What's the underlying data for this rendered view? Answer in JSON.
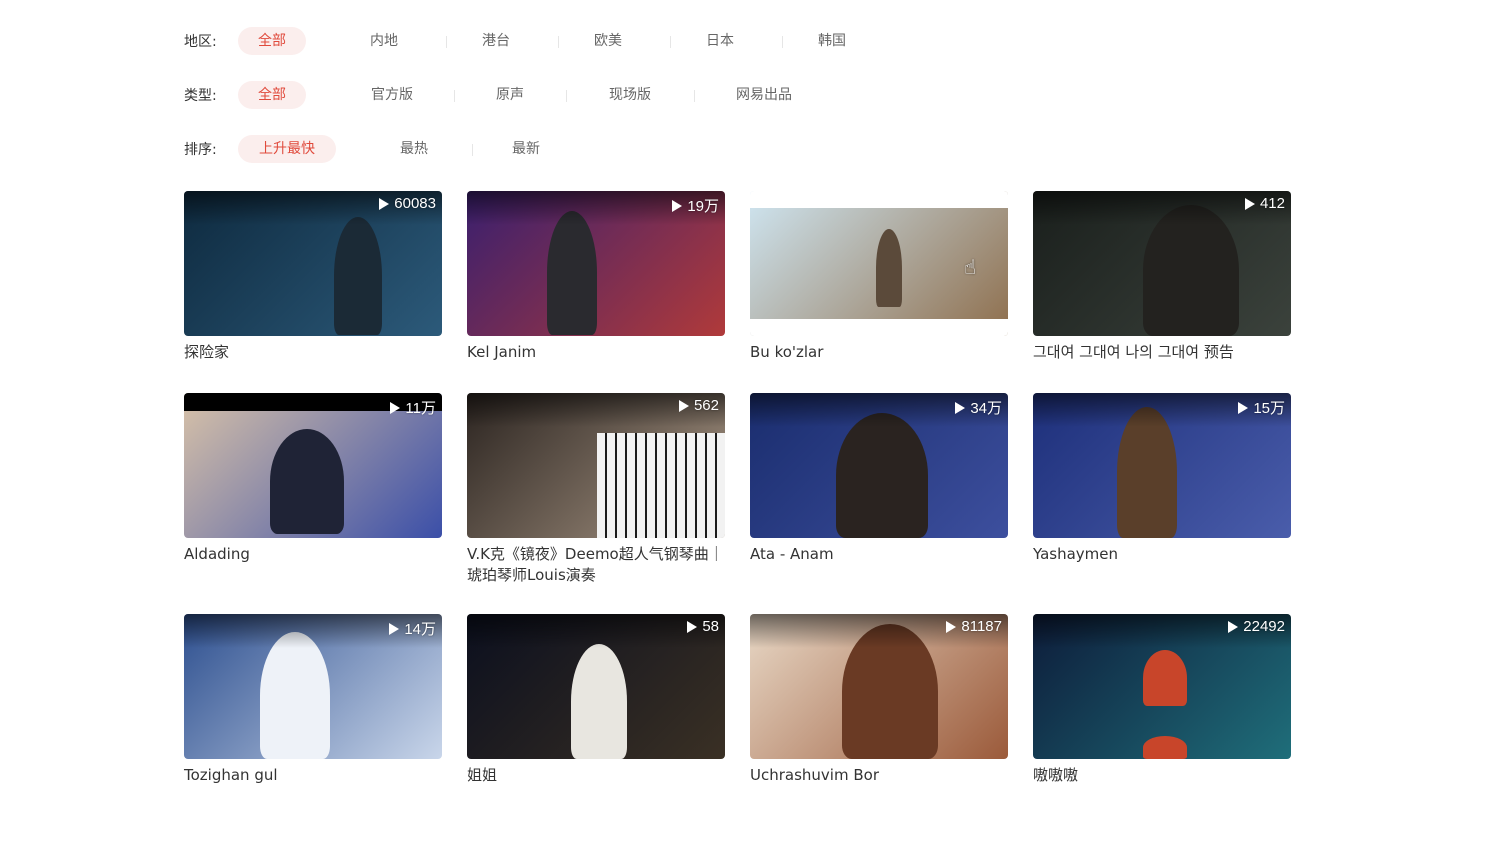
{
  "filters": {
    "region": {
      "label": "地区:",
      "options": [
        "全部",
        "内地",
        "港台",
        "欧美",
        "日本",
        "韩国"
      ],
      "active": "全部"
    },
    "type": {
      "label": "类型:",
      "options": [
        "全部",
        "官方版",
        "原声",
        "现场版",
        "网易出品"
      ],
      "active": "全部"
    },
    "sort": {
      "label": "排序:",
      "options": [
        "上升最快",
        "最热",
        "最新"
      ],
      "active": "上升最快"
    }
  },
  "videos": [
    {
      "title": "探险家",
      "plays": "60083",
      "thumb_colors": [
        "#0e2a3f",
        "#2c5a7a"
      ]
    },
    {
      "title": "Kel Janim",
      "plays": "19万",
      "thumb_colors": [
        "#3a1f6e",
        "#b03a3a"
      ]
    },
    {
      "title": "Bu ko'zlar",
      "plays": "",
      "thumb_colors": [
        "#cfe6f2",
        "#8e6e4c"
      ]
    },
    {
      "title": "그대여 그대여 나의 그대여 预告",
      "plays": "412",
      "thumb_colors": [
        "#1a1f1c",
        "#3b423c"
      ]
    },
    {
      "title": "Aldading",
      "plays": "11万",
      "thumb_colors": [
        "#d8c2a8",
        "#3b4fa8"
      ]
    },
    {
      "title": "V.K克《镜夜》Deemo超人气钢琴曲｜琥珀琴师Louis演奏",
      "plays": "562",
      "thumb_colors": [
        "#2b2420",
        "#a89684"
      ]
    },
    {
      "title": "Ata - Anam",
      "plays": "34万",
      "thumb_colors": [
        "#1a2d6e",
        "#3d4f9e"
      ]
    },
    {
      "title": "Yashaymen",
      "plays": "15万",
      "thumb_colors": [
        "#1d2f7a",
        "#4a5dab"
      ]
    },
    {
      "title": "Tozighan gul",
      "plays": "14万",
      "thumb_colors": [
        "#2d4f8f",
        "#c9d6ea"
      ]
    },
    {
      "title": "姐姐",
      "plays": "58",
      "thumb_colors": [
        "#0b0f1e",
        "#3a3024"
      ]
    },
    {
      "title": "Uchrashuvim Bor",
      "plays": "81187",
      "thumb_colors": [
        "#e8d8c6",
        "#9b5a3a"
      ]
    },
    {
      "title": "嗷嗷嗷",
      "plays": "22492",
      "thumb_colors": [
        "#0d1c3a",
        "#1f6e7a"
      ]
    }
  ]
}
